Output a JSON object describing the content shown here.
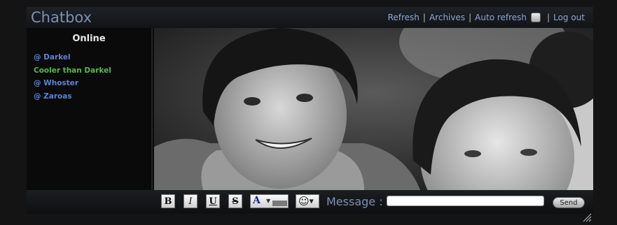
{
  "header": {
    "title": "Chatbox",
    "links": {
      "refresh": "Refresh",
      "archives": "Archives",
      "auto_refresh": "Auto refresh",
      "logout": "Log out",
      "separator": "|"
    }
  },
  "sidebar": {
    "heading": "Online",
    "users": [
      {
        "label": "@ Darkel",
        "color": "#5b82d6"
      },
      {
        "label": "Cooler than Darkel",
        "color": "#56b84a"
      },
      {
        "label": "@ Whoster",
        "color": "#5b82d6"
      },
      {
        "label": "@ Zaroas",
        "color": "#5b82d6"
      }
    ]
  },
  "toolbar": {
    "bold": "B",
    "italic": "I",
    "underline": "U",
    "strike": "S",
    "color_letter": "A",
    "smiley": "☺",
    "message_label": "Message :",
    "message_value": "",
    "send": "Send"
  },
  "icons": {
    "color_picker": "font-color-icon",
    "smiley": "smiley-icon",
    "resize": "resize-grip-icon"
  }
}
